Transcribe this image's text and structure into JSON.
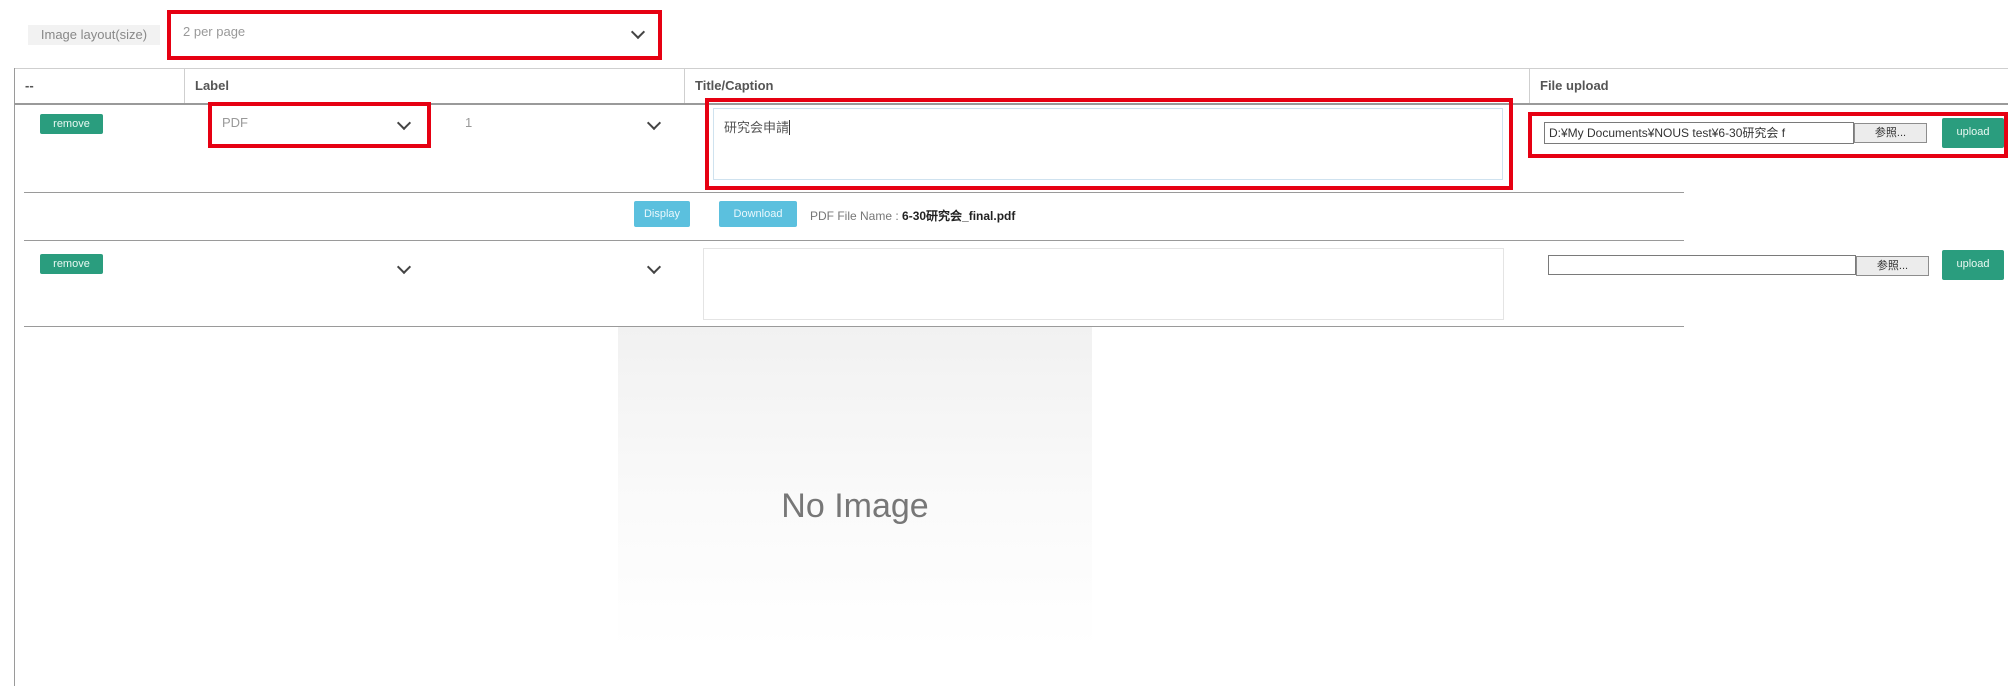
{
  "layout_selector": {
    "label": "Image layout(size)",
    "value": "2 per page"
  },
  "table": {
    "headers": {
      "control": "--",
      "label": "Label",
      "title": "Title/Caption",
      "file": "File upload"
    }
  },
  "rows": [
    {
      "remove_label": "remove",
      "type_value": "PDF",
      "number_value": "1",
      "caption_value": "研究会申請",
      "file_path": "D:¥My Documents¥NOUS test¥6-30研究会 f",
      "browse_label": "参照...",
      "upload_label": "upload"
    },
    {
      "remove_label": "remove",
      "type_value": "",
      "number_value": "",
      "caption_value": "",
      "file_path": "",
      "browse_label": "参照...",
      "upload_label": "upload"
    }
  ],
  "pdf_actions": {
    "display_label": "Display",
    "download_label": "Download",
    "file_name_label": "PDF File Name :",
    "file_name_value": "6-30研究会_final.pdf"
  },
  "preview": {
    "text": "No Image"
  },
  "colors": {
    "highlight": "#e60012",
    "green_button": "#2a9d7e",
    "blue_button": "#5bc0de"
  }
}
